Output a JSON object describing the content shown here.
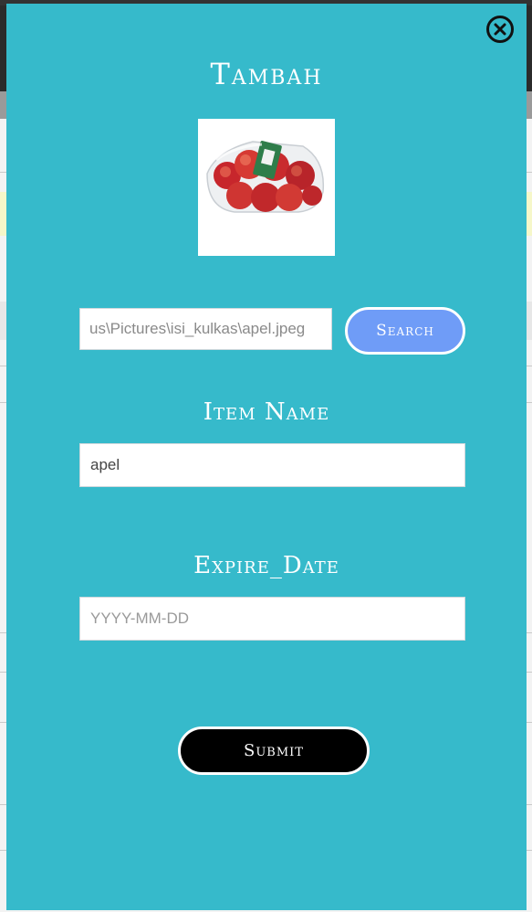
{
  "modal": {
    "title": "Tambah",
    "close_icon": "close-circle-icon",
    "image_alt": "apel",
    "file": {
      "path_value": "us\\Pictures\\isi_kulkas\\apel.jpeg",
      "search_label": "Search"
    },
    "item_name": {
      "label": "Item Name",
      "value": "apel"
    },
    "expire_date": {
      "label": "Expire_Date",
      "placeholder": "YYYY-MM-DD"
    },
    "submit_label": "Submit"
  },
  "colors": {
    "modal_bg": "#36bacb",
    "search_button": "#6f9cf7",
    "submit_button": "#000000"
  }
}
